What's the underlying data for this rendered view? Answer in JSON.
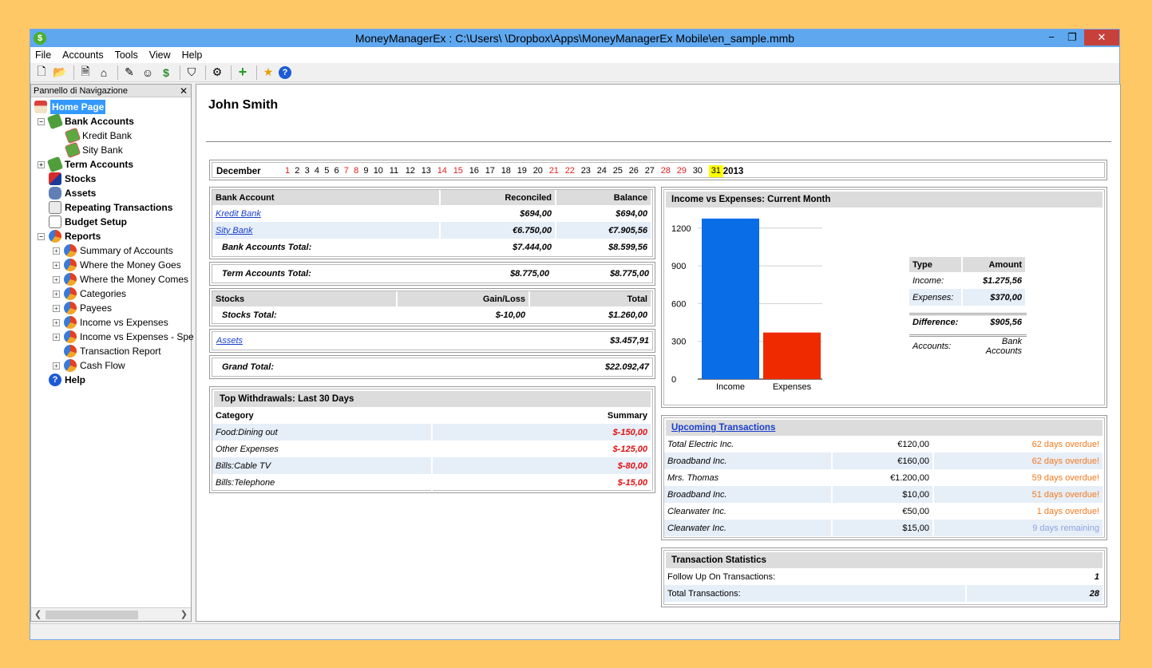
{
  "window": {
    "title": "MoneyManagerEx : C:\\Users\\              \\Dropbox\\Apps\\MoneyManagerEx Mobile\\en_sample.mmb",
    "app_icon_glyph": "$",
    "minimize_glyph": "−",
    "maximize_glyph": "❐",
    "close_glyph": "✕"
  },
  "menu": [
    "File",
    "Accounts",
    "Tools",
    "View",
    "Help"
  ],
  "toolbar_icons": [
    "new-database-icon",
    "open-database-icon",
    "new-account-icon",
    "home-icon",
    "edit-payees-icon",
    "edit-categories-icon",
    "currency-icon",
    "filter-icon",
    "options-icon",
    "new-transaction-icon",
    "favorite-icon",
    "help-icon"
  ],
  "nav": {
    "header": "Pannello di Navigazione",
    "close_glyph": "✕",
    "items": [
      {
        "label": "Home Page"
      },
      {
        "label": "Bank Accounts"
      },
      {
        "label": "Kredit Bank"
      },
      {
        "label": "Sity Bank"
      },
      {
        "label": "Term Accounts"
      },
      {
        "label": "Stocks"
      },
      {
        "label": "Assets"
      },
      {
        "label": "Repeating Transactions"
      },
      {
        "label": "Budget Setup"
      },
      {
        "label": "Reports"
      },
      {
        "label": "Summary of Accounts"
      },
      {
        "label": "Where the Money Goes"
      },
      {
        "label": "Where the Money Comes"
      },
      {
        "label": "Categories"
      },
      {
        "label": "Payees"
      },
      {
        "label": "Income vs Expenses"
      },
      {
        "label": "Income vs Expenses - Spe"
      },
      {
        "label": "Transaction Report"
      },
      {
        "label": "Cash Flow"
      },
      {
        "label": "Help"
      }
    ]
  },
  "home": {
    "owner": "John Smith",
    "calendar": {
      "month": "December",
      "year": "2013",
      "today": "31",
      "days": [
        "1",
        "2",
        "3",
        "4",
        "5",
        "6",
        "7",
        "8",
        "9",
        "10",
        "11",
        "12",
        "13",
        "14",
        "15",
        "16",
        "17",
        "18",
        "19",
        "20",
        "21",
        "22",
        "23",
        "24",
        "25",
        "26",
        "27",
        "28",
        "29",
        "30",
        "31"
      ],
      "weekend_days": [
        "1",
        "7",
        "8",
        "14",
        "15",
        "21",
        "22",
        "28",
        "29"
      ]
    },
    "bank": {
      "headers": [
        "Bank Account",
        "Reconciled",
        "Balance"
      ],
      "rows": [
        {
          "name": "Kredit Bank",
          "reconciled": "$694,00",
          "balance": "$694,00"
        },
        {
          "name": "Sity Bank",
          "reconciled": "€6.750,00",
          "balance": "€7.905,56"
        }
      ],
      "total_label": "Bank Accounts Total:",
      "total_reconciled": "$7.444,00",
      "total_balance": "$8.599,56"
    },
    "term": {
      "label": "Term Accounts Total:",
      "reconciled": "$8.775,00",
      "balance": "$8.775,00"
    },
    "stocks": {
      "headers": [
        "Stocks",
        "Gain/Loss",
        "Total"
      ],
      "total_label": "Stocks Total:",
      "gain": "$-10,00",
      "total": "$1.260,00"
    },
    "assets": {
      "label": "Assets",
      "value": "$3.457,91"
    },
    "grand": {
      "label": "Grand Total:",
      "value": "$22.092,47"
    },
    "withdrawals": {
      "title": "Top Withdrawals: Last 30 Days",
      "headers": [
        "Category",
        "Summary"
      ],
      "rows": [
        {
          "category": "Food:Dining out",
          "amount": "$-150,00"
        },
        {
          "category": "Other Expenses",
          "amount": "$-125,00"
        },
        {
          "category": "Bills:Cable TV",
          "amount": "$-80,00"
        },
        {
          "category": "Bills:Telephone",
          "amount": "$-15,00"
        }
      ]
    },
    "income_chart": {
      "title": "Income vs Expenses: Current Month",
      "legend_headers": [
        "Type",
        "Amount"
      ],
      "income_label": "Income:",
      "income_value": "$1.275,56",
      "expenses_label": "Expenses:",
      "expenses_value": "$370,00",
      "difference_label": "Difference:",
      "difference_value": "$905,56",
      "accounts_label": "Accounts:",
      "accounts_value": "Bank Accounts"
    },
    "upcoming": {
      "title": "Upcoming Transactions",
      "rows": [
        {
          "payee": "Total Electric Inc.",
          "amount": "€120,00",
          "status": "62 days overdue!",
          "kind": "overdue"
        },
        {
          "payee": "Broadband Inc.",
          "amount": "€160,00",
          "status": "62 days overdue!",
          "kind": "overdue"
        },
        {
          "payee": "Mrs. Thomas",
          "amount": "€1.200,00",
          "status": "59 days overdue!",
          "kind": "overdue"
        },
        {
          "payee": "Broadband Inc.",
          "amount": "$10,00",
          "status": "51 days overdue!",
          "kind": "overdue"
        },
        {
          "payee": "Clearwater Inc.",
          "amount": "€50,00",
          "status": "1 days overdue!",
          "kind": "overdue"
        },
        {
          "payee": "Clearwater Inc.",
          "amount": "$15,00",
          "status": "9 days remaining",
          "kind": "remaining"
        }
      ]
    },
    "stats": {
      "title": "Transaction Statistics",
      "rows": [
        {
          "label": "Follow Up On Transactions:",
          "value": "1"
        },
        {
          "label": "Total Transactions:",
          "value": "28"
        }
      ]
    }
  },
  "chart_data": {
    "type": "bar",
    "title": "",
    "categories": [
      "Income",
      "Expenses"
    ],
    "values": [
      1275.56,
      370.0
    ],
    "colors": [
      "#0a6de8",
      "#f02a00"
    ],
    "yticks": [
      0,
      300,
      600,
      900,
      1200
    ],
    "ylim": [
      0,
      1300
    ],
    "grid": true,
    "legend": "none"
  },
  "colors": {
    "title_bar": "#5fa8f0",
    "close_button": "#c7413a",
    "header_gray": "#dcdcdc",
    "alt_row": "#e6eef8",
    "negative": "#e01010",
    "overdue": "#f47a1f",
    "remaining": "#8fa4e0",
    "today_highlight": "#ffff00"
  }
}
